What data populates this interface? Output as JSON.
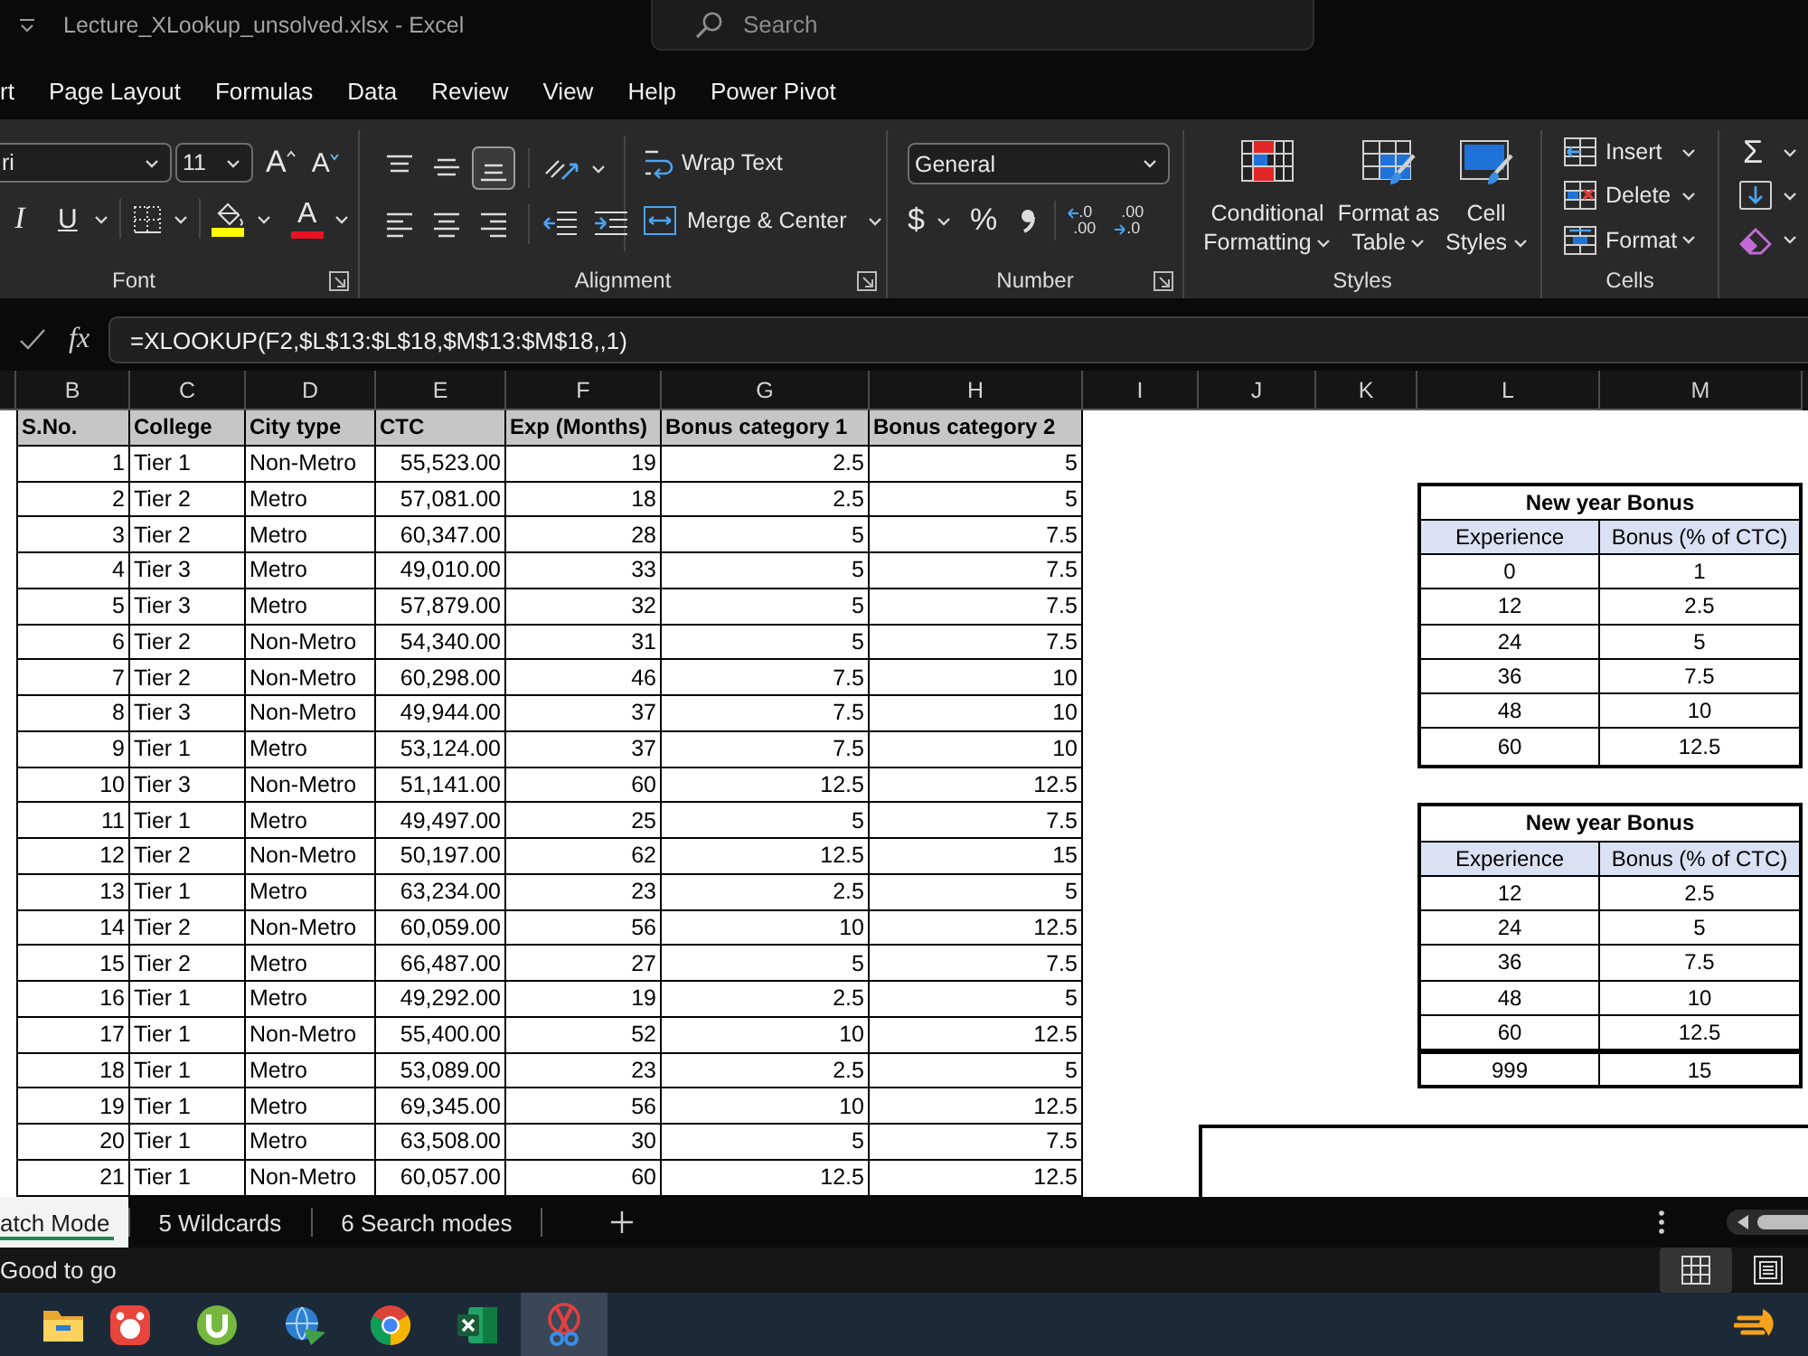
{
  "window": {
    "title": "Lecture_XLookup_unsolved.xlsx - Excel"
  },
  "search": {
    "placeholder": "Search"
  },
  "menu_tabs": [
    {
      "label": "rt",
      "selected": false
    },
    {
      "label": "Page Layout",
      "selected": false
    },
    {
      "label": "Formulas",
      "selected": false
    },
    {
      "label": "Data",
      "selected": false
    },
    {
      "label": "Review",
      "selected": false
    },
    {
      "label": "View",
      "selected": false
    },
    {
      "label": "Help",
      "selected": false
    },
    {
      "label": "Power Pivot",
      "selected": false
    }
  ],
  "ribbon": {
    "font": {
      "label": "Font",
      "font_name": "ri",
      "font_size": "11",
      "grow_glyph": "A",
      "shrink_glyph": "A",
      "italic_glyph": "I",
      "underline_glyph": "U",
      "font_color_glyph": "A"
    },
    "alignment": {
      "label": "Alignment",
      "vertical": [
        {
          "selected": false
        },
        {
          "selected": false
        },
        {
          "selected": true
        }
      ],
      "horizontal": [
        {
          "selected": false
        },
        {
          "selected": false
        },
        {
          "selected": false
        }
      ],
      "wrap_text": "Wrap Text",
      "merge_center": "Merge & Center"
    },
    "number": {
      "label": "Number",
      "format": "General",
      "currency_glyph": "$",
      "percent_glyph": "%",
      "increase_decimal": {
        "top": ".0",
        "bottom": ".00"
      },
      "decrease_decimal": {
        "top": ".00",
        "bottom": ".0"
      }
    },
    "styles": {
      "label": "Styles",
      "buttons": [
        {
          "kind": "conditional",
          "lines": [
            "Conditional",
            "Formatting"
          ]
        },
        {
          "kind": "table",
          "lines": [
            "Format as",
            "Table"
          ]
        },
        {
          "kind": "cell",
          "lines": [
            "Cell",
            "Styles"
          ]
        }
      ]
    },
    "cells": {
      "label": "Cells",
      "buttons": [
        {
          "kind": "insert",
          "label": "Insert"
        },
        {
          "kind": "delete",
          "label": "Delete"
        },
        {
          "kind": "format",
          "label": "Format"
        }
      ]
    },
    "editing": {
      "sum_glyph": "Σ"
    }
  },
  "formula_bar": {
    "function_glyph": "fx",
    "formula": "=XLOOKUP(F2,$L$13:$L$18,$M$13:$M$18,,1)"
  },
  "sheet": {
    "columns": [
      "B",
      "C",
      "D",
      "E",
      "F",
      "G",
      "H",
      "I",
      "J",
      "K",
      "L",
      "M"
    ],
    "table": {
      "columns": [
        "S.No.",
        "College",
        "City type",
        "CTC",
        "Exp (Months)",
        "Bonus category 1",
        "Bonus category 2"
      ],
      "rows": [
        [
          "1",
          "Tier 1",
          "Non-Metro",
          "55,523.00",
          "19",
          "2.5",
          "5"
        ],
        [
          "2",
          "Tier 2",
          "Metro",
          "57,081.00",
          "18",
          "2.5",
          "5"
        ],
        [
          "3",
          "Tier 2",
          "Metro",
          "60,347.00",
          "28",
          "5",
          "7.5"
        ],
        [
          "4",
          "Tier 3",
          "Metro",
          "49,010.00",
          "33",
          "5",
          "7.5"
        ],
        [
          "5",
          "Tier 3",
          "Metro",
          "57,879.00",
          "32",
          "5",
          "7.5"
        ],
        [
          "6",
          "Tier 2",
          "Non-Metro",
          "54,340.00",
          "31",
          "5",
          "7.5"
        ],
        [
          "7",
          "Tier 2",
          "Non-Metro",
          "60,298.00",
          "46",
          "7.5",
          "10"
        ],
        [
          "8",
          "Tier 3",
          "Non-Metro",
          "49,944.00",
          "37",
          "7.5",
          "10"
        ],
        [
          "9",
          "Tier 1",
          "Metro",
          "53,124.00",
          "37",
          "7.5",
          "10"
        ],
        [
          "10",
          "Tier 3",
          "Non-Metro",
          "51,141.00",
          "60",
          "12.5",
          "12.5"
        ],
        [
          "11",
          "Tier 1",
          "Metro",
          "49,497.00",
          "25",
          "5",
          "7.5"
        ],
        [
          "12",
          "Tier 2",
          "Non-Metro",
          "50,197.00",
          "62",
          "12.5",
          "15"
        ],
        [
          "13",
          "Tier 1",
          "Metro",
          "63,234.00",
          "23",
          "2.5",
          "5"
        ],
        [
          "14",
          "Tier 2",
          "Non-Metro",
          "60,059.00",
          "56",
          "10",
          "12.5"
        ],
        [
          "15",
          "Tier 2",
          "Metro",
          "66,487.00",
          "27",
          "5",
          "7.5"
        ],
        [
          "16",
          "Tier 1",
          "Metro",
          "49,292.00",
          "19",
          "2.5",
          "5"
        ],
        [
          "17",
          "Tier 1",
          "Non-Metro",
          "55,400.00",
          "52",
          "10",
          "12.5"
        ],
        [
          "18",
          "Tier 1",
          "Metro",
          "53,089.00",
          "23",
          "2.5",
          "5"
        ],
        [
          "19",
          "Tier 1",
          "Metro",
          "69,345.00",
          "56",
          "10",
          "12.5"
        ],
        [
          "20",
          "Tier 1",
          "Metro",
          "63,508.00",
          "30",
          "5",
          "7.5"
        ],
        [
          "21",
          "Tier 1",
          "Non-Metro",
          "60,057.00",
          "60",
          "12.5",
          "12.5"
        ]
      ]
    },
    "lookup_tables": [
      {
        "title": "New year Bonus",
        "columns": [
          "Experience",
          "Bonus (% of CTC)"
        ],
        "rows": [
          [
            "0",
            "1"
          ],
          [
            "12",
            "2.5"
          ],
          [
            "24",
            "5"
          ],
          [
            "36",
            "7.5"
          ],
          [
            "48",
            "10"
          ],
          [
            "60",
            "12.5"
          ]
        ]
      },
      {
        "title": "New year Bonus",
        "columns": [
          "Experience",
          "Bonus (% of CTC)"
        ],
        "rows": [
          [
            "12",
            "2.5"
          ],
          [
            "24",
            "5"
          ],
          [
            "36",
            "7.5"
          ],
          [
            "48",
            "10"
          ],
          [
            "60",
            "12.5"
          ]
        ],
        "appended_rows": [
          [
            "999",
            "15"
          ]
        ]
      }
    ]
  },
  "sheet_tabs": [
    {
      "label": "atch Mode",
      "selected": true
    },
    {
      "label": "5 Wildcards",
      "selected": false
    },
    {
      "label": "6 Search modes",
      "selected": false
    }
  ],
  "status_bar": {
    "message": "Good to go",
    "view_buttons": [
      {
        "kind": "normal",
        "selected": true
      },
      {
        "kind": "page_layout",
        "selected": false
      }
    ]
  },
  "taskbar": {
    "apps": [
      {
        "kind": "folder",
        "selected": false
      },
      {
        "kind": "badge",
        "selected": false
      },
      {
        "kind": "torrent",
        "selected": false
      },
      {
        "kind": "download",
        "selected": false
      },
      {
        "kind": "browser",
        "selected": false
      },
      {
        "kind": "spreadsheet",
        "selected": false
      },
      {
        "kind": "snipping",
        "selected": true
      }
    ],
    "tray": [
      {
        "kind": "flame"
      }
    ]
  }
}
